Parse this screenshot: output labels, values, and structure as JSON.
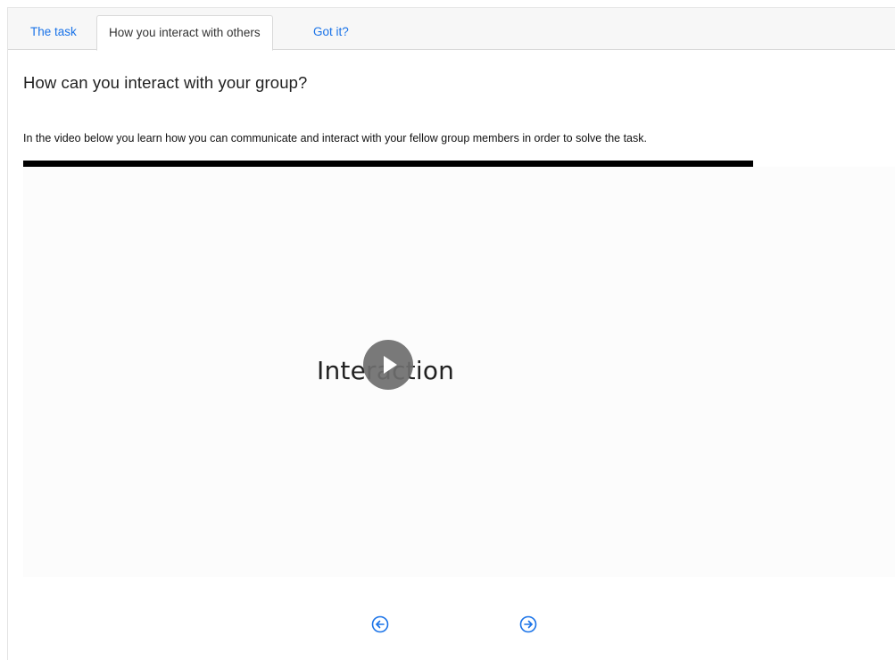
{
  "tabs": [
    {
      "label": "The task",
      "active": false
    },
    {
      "label": "How you interact with others",
      "active": true
    },
    {
      "label": "Got it?",
      "active": false
    }
  ],
  "main": {
    "heading": "How can you interact with your group?",
    "intro": "In the video below you learn how you can communicate and interact with your fellow group members in order to solve the task."
  },
  "video": {
    "title": "Interaction",
    "play_icon": "play-icon"
  },
  "navigation": {
    "prev_icon": "arrow-left-circle-icon",
    "next_icon": "arrow-right-circle-icon"
  },
  "colors": {
    "link": "#1a73e8",
    "progress": "#000000",
    "play_bg": "#6e6e6e"
  }
}
